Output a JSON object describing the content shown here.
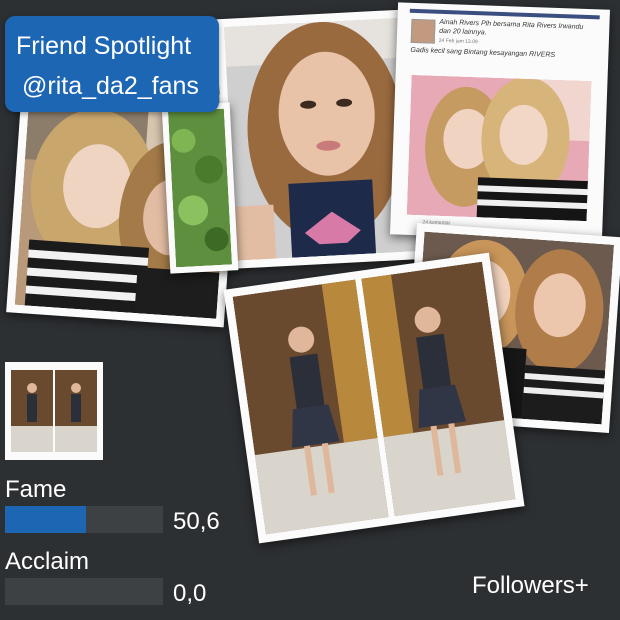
{
  "badge": {
    "line1": "Friend Spotlight",
    "line2": "@rita_da2_fans"
  },
  "post": {
    "author": "Ainah Rivers Plh bersama Rita Rivers Irwandu dan 20 lainnya.",
    "date": "24 Feb jam 13.09 · ",
    "caption": "Gadis kecil sang Bintang kesayangan RIVERS",
    "comments": "24 komentar"
  },
  "stats": [
    {
      "label": "Fame",
      "value": "50,6",
      "fill_percent": 51
    },
    {
      "label": "Acclaim",
      "value": "0,0",
      "fill_percent": 0
    }
  ],
  "followers_button": "Followers+",
  "colors": {
    "background": "#2d3033",
    "accent": "#1d66b4",
    "bar_track": "#3e4144",
    "text": "#ffffff",
    "card": "#fbfbfb"
  }
}
